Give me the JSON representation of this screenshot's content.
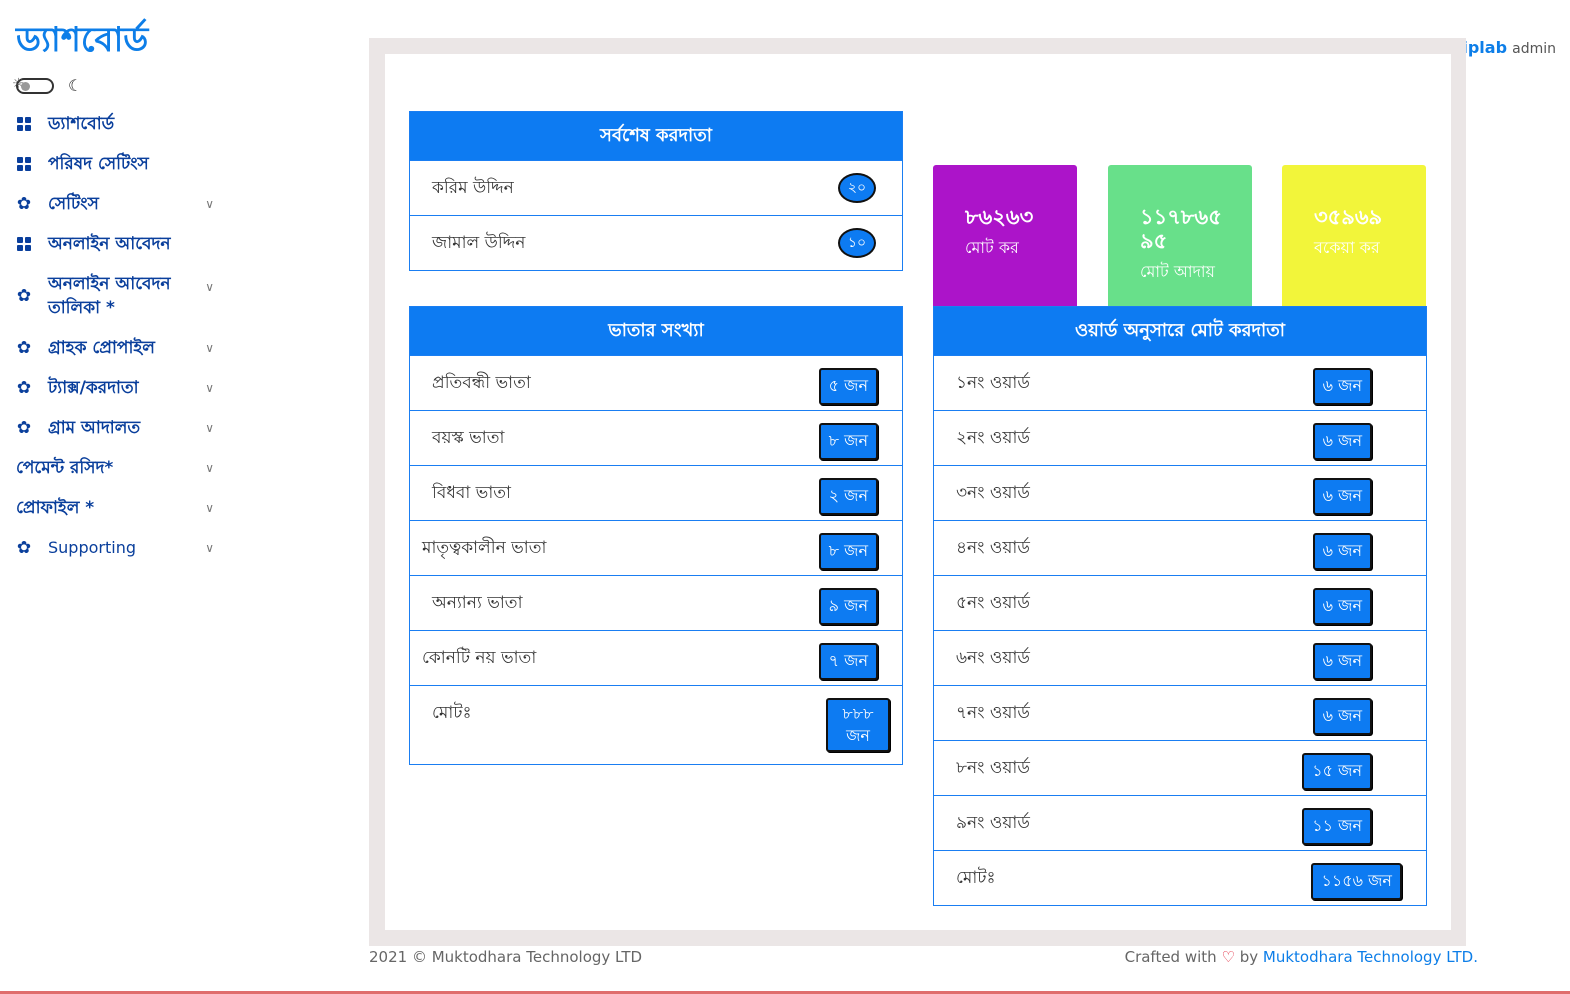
{
  "brand": "ড্যাশবোর্ড",
  "sidebar": {
    "items": [
      {
        "label": "ড্যাশবোর্ড",
        "icon": "grid-icon"
      },
      {
        "label": "পরিষদ সেটিংস",
        "icon": "grid-icon"
      },
      {
        "label": "সেটিংস",
        "icon": "gear-icon"
      },
      {
        "label": "অনলাইন আবেদন",
        "icon": "grid-icon"
      },
      {
        "label": "অনলাইন আবেদন তালিকা *",
        "icon": "gear-icon"
      },
      {
        "label": "গ্রাহক প্রোপাইল",
        "icon": "gear-icon"
      },
      {
        "label": "ট্যাক্স/করদাতা",
        "icon": "gear-icon"
      },
      {
        "label": "গ্রাম আদালত",
        "icon": "gear-icon"
      },
      {
        "label": "পেমেন্ট রসিদ*",
        "icon": ""
      },
      {
        "label": "প্রোফাইল *",
        "icon": ""
      },
      {
        "label": "Supporting",
        "icon": "gear-icon"
      }
    ]
  },
  "user": {
    "name": "biplab",
    "role": "admin"
  },
  "latest_taxpayers": {
    "title": "সর্বশেষ করদাতা",
    "rows": [
      {
        "name": "করিম উদ্দিন",
        "value": "২০"
      },
      {
        "name": "জামাল উদ্দিন",
        "value": "১০"
      }
    ]
  },
  "stats": [
    {
      "value": "৮৬২৬৩",
      "label": "মোট কর",
      "color": "#ac14c9"
    },
    {
      "value": "১১৭৮৬৫ ৯৫",
      "label": "মোট আদায়",
      "color": "#68e08a"
    },
    {
      "value": "৩৫৯৬৯",
      "label": "বকেয়া কর",
      "color": "#f2f53a"
    }
  ],
  "allowance": {
    "title": "ভাতার সংখ্যা",
    "rows": [
      {
        "name": "প্রতিবন্ধী ভাতা",
        "value": "৫ জন"
      },
      {
        "name": "বয়স্ক ভাতা",
        "value": "৮ জন"
      },
      {
        "name": "বিধবা ভাতা",
        "value": "২ জন"
      },
      {
        "name": "মাতৃত্বকালীন ভাতা",
        "value": "৮ জন"
      },
      {
        "name": "অন্যান্য ভাতা",
        "value": "৯ জন"
      },
      {
        "name": "কোনটি নয় ভাতা",
        "value": "৭ জন"
      }
    ],
    "total_label": "মোটঃ",
    "total_value": "৮৮৮ জন"
  },
  "ward_taxpayers": {
    "title": "ওয়ার্ড অনুসারে মোট করদাতা",
    "rows": [
      {
        "name": "১নং ওয়ার্ড",
        "value": "৬ জন"
      },
      {
        "name": "২নং ওয়ার্ড",
        "value": "৬ জন"
      },
      {
        "name": "৩নং ওয়ার্ড",
        "value": "৬ জন"
      },
      {
        "name": "৪নং ওয়ার্ড",
        "value": "৬ জন"
      },
      {
        "name": "৫নং ওয়ার্ড",
        "value": "৬ জন"
      },
      {
        "name": "৬নং ওয়ার্ড",
        "value": "৬ জন"
      },
      {
        "name": "৭নং ওয়ার্ড",
        "value": "৬ জন"
      },
      {
        "name": "৮নং ওয়ার্ড",
        "value": "১৫ জন"
      },
      {
        "name": "৯নং ওয়ার্ড",
        "value": "১১ জন"
      }
    ],
    "total_label": "মোটঃ",
    "total_value": "১১৫৬ জন"
  },
  "footer": {
    "copyright": "2021 © Muktodhara Technology LTD",
    "crafted_prefix": "Crafted with",
    "crafted_by": "by",
    "company_link": "Muktodhara Technology LTD",
    "period": "."
  }
}
